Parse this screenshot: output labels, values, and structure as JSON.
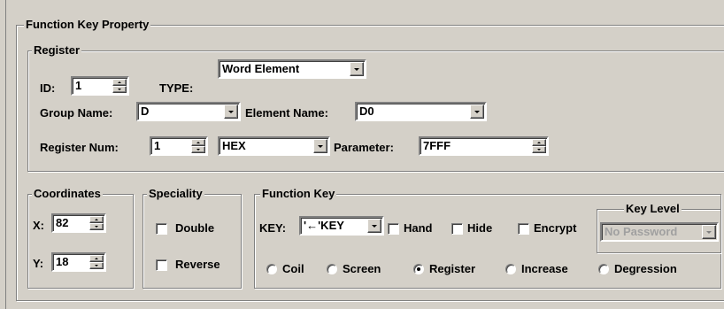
{
  "panel": {
    "title": "Function Key Property"
  },
  "register": {
    "title": "Register",
    "id_label": "ID:",
    "id_value": "1",
    "type_label": "TYPE:",
    "type_value": "Word Element",
    "group_name_label": "Group Name:",
    "group_name_value": "D",
    "element_name_label": "Element Name:",
    "element_name_value": "D0",
    "register_num_label": "Register Num:",
    "register_num_value": "1",
    "format_value": "HEX",
    "parameter_label": "Parameter:",
    "parameter_value": "7FFF"
  },
  "coordinates": {
    "title": "Coordinates",
    "x_label": "X:",
    "x_value": "82",
    "y_label": "Y:",
    "y_value": "18"
  },
  "speciality": {
    "title": "Speciality",
    "double_label": "Double",
    "double_checked": false,
    "reverse_label": "Reverse",
    "reverse_checked": false
  },
  "function_key": {
    "title": "Function Key",
    "key_label": "KEY:",
    "key_value": "'←'KEY",
    "hand_label": "Hand",
    "hide_label": "Hide",
    "encrypt_label": "Encrypt",
    "key_level": {
      "title": "Key Level",
      "value": "No Password"
    },
    "modes": [
      {
        "label": "Coil",
        "selected": false
      },
      {
        "label": "Screen",
        "selected": false
      },
      {
        "label": "Register",
        "selected": true
      },
      {
        "label": "Increase",
        "selected": false
      },
      {
        "label": "Degression",
        "selected": false
      }
    ]
  }
}
